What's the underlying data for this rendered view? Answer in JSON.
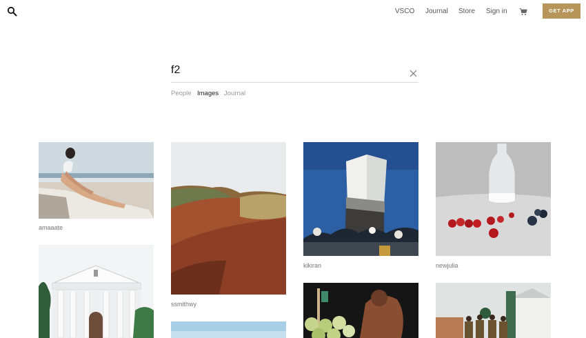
{
  "header": {
    "nav": {
      "vsco": "VSCO",
      "journal": "Journal",
      "store": "Store",
      "sign_in": "Sign in"
    },
    "get_app": "GET APP"
  },
  "search": {
    "query": "f2",
    "tabs": [
      {
        "label": "People",
        "active": false
      },
      {
        "label": "Images",
        "active": true
      },
      {
        "label": "Journal",
        "active": false
      }
    ]
  },
  "results": [
    {
      "user": "amaaate"
    },
    {
      "user": "ssmithwy"
    },
    {
      "user": "kikiran"
    },
    {
      "user": "newjulia"
    }
  ],
  "colors": {
    "accent": "#b7955a"
  },
  "icons": {
    "search": "search-icon",
    "cart": "cart-icon",
    "clear": "close-icon"
  }
}
